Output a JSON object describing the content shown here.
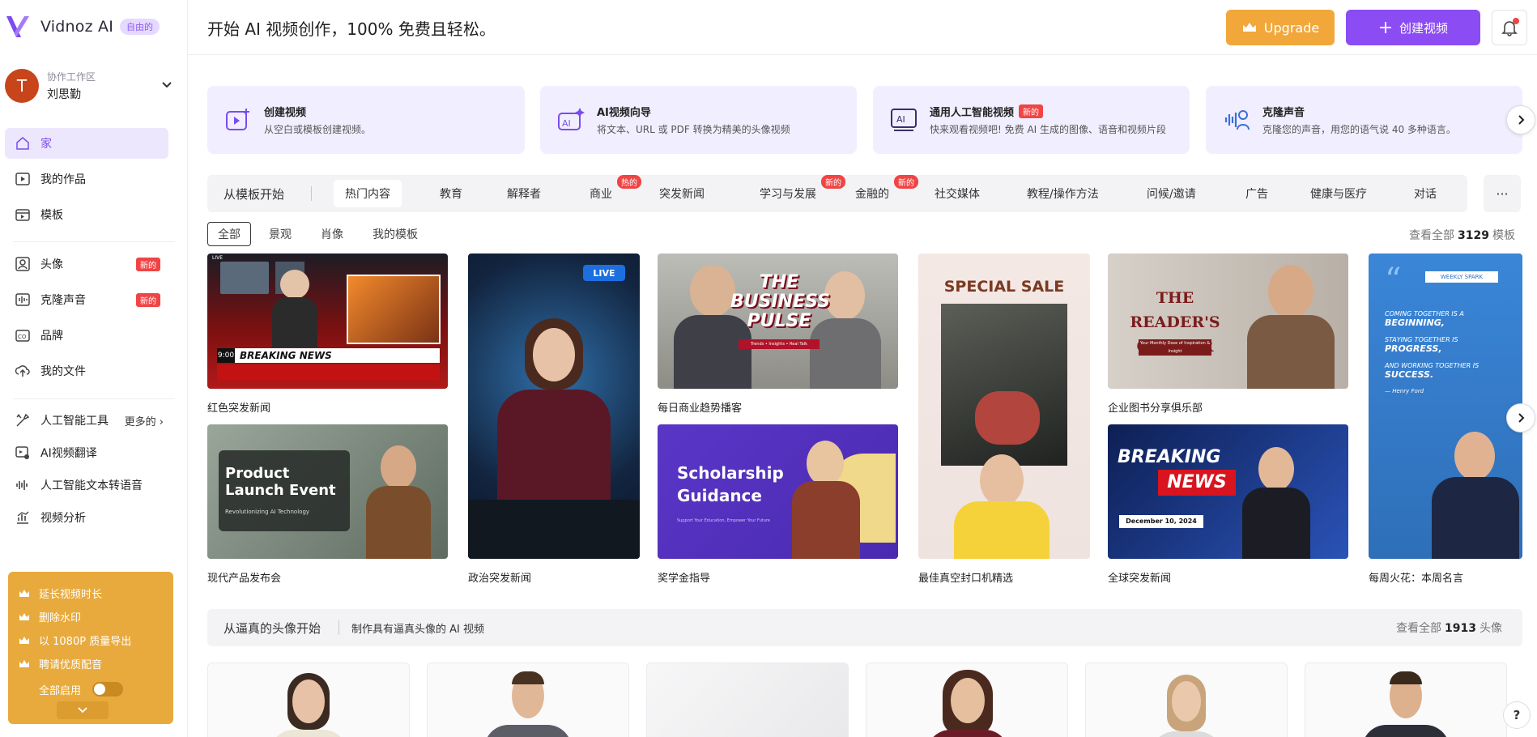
{
  "brand": {
    "name": "Vidnoz AI",
    "tag": "自由的"
  },
  "workspace": {
    "label": "协作工作区",
    "user": "刘思勤",
    "initial": "T"
  },
  "sidebar": {
    "items": [
      {
        "label": "家",
        "icon": "home-icon"
      },
      {
        "label": "我的作品",
        "icon": "video-icon"
      },
      {
        "label": "模板",
        "icon": "template-icon"
      },
      {
        "label": "头像",
        "icon": "avatar-icon",
        "badge": "新的"
      },
      {
        "label": "克隆声音",
        "icon": "voice-icon",
        "badge": "新的"
      },
      {
        "label": "品牌",
        "icon": "brand-icon"
      },
      {
        "label": "我的文件",
        "icon": "upload-icon"
      }
    ],
    "tools": {
      "label": "人工智能工具",
      "more": "更多的",
      "items": [
        {
          "label": "AI视频翻译",
          "icon": "translate-icon"
        },
        {
          "label": "人工智能文本转语音",
          "icon": "waveform-icon"
        },
        {
          "label": "视频分析",
          "icon": "analytics-icon"
        }
      ]
    },
    "promo": {
      "items": [
        "延长视频时长",
        "删除水印",
        "以 1080P 质量导出",
        "聘请优质配音"
      ],
      "toggle_label": "全部启用"
    }
  },
  "header": {
    "title": "开始 AI 视频创作，100% 免费且轻松。",
    "upgrade": "Upgrade",
    "create": "创建视频"
  },
  "features": [
    {
      "title": "创建视频",
      "desc": "从空白或模板创建视频。"
    },
    {
      "title": "AI视频向导",
      "desc": "将文本、URL 或 PDF 转换为精美的头像视频"
    },
    {
      "title": "通用人工智能视频",
      "badge": "新的",
      "desc": "快来观看视频吧! 免费 AI 生成的图像、语音和视频片段"
    },
    {
      "title": "克隆声音",
      "desc": "克隆您的声音，用您的语气说 40 多种语言。"
    }
  ],
  "categories": {
    "start_label": "从模板开始",
    "tabs": [
      {
        "label": "热门内容"
      },
      {
        "label": "教育"
      },
      {
        "label": "解释者"
      },
      {
        "label": "商业",
        "badge": "热的"
      },
      {
        "label": "突发新闻"
      },
      {
        "label": "学习与发展",
        "badge": "新的"
      },
      {
        "label": "金融的",
        "badge": "新的"
      },
      {
        "label": "社交媒体"
      },
      {
        "label": "教程/操作方法"
      },
      {
        "label": "问候/邀请"
      },
      {
        "label": "广告"
      },
      {
        "label": "健康与医疗"
      },
      {
        "label": "对话"
      }
    ],
    "more": "···"
  },
  "filters": [
    "全部",
    "景观",
    "肖像",
    "我的模板"
  ],
  "templates_viewall": {
    "prefix": "查看全部",
    "count": "3129",
    "suffix": "模板"
  },
  "templates": [
    {
      "caption": "红色突发新闻",
      "overlay": "BREAKING NEWS",
      "time": "9:00",
      "live": "LIVE"
    },
    {
      "caption": "政治突发新闻",
      "live": "LIVE"
    },
    {
      "caption": "每日商业趋势播客",
      "overlay": "THE BUSINESS PULSE",
      "sub": "Trends • Insights • Real Talk"
    },
    {
      "caption": "最佳真空封口机精选",
      "overlay": "SPECIAL SALE"
    },
    {
      "caption": "企业图书分享俱乐部",
      "overlay": "THE READER'S CORNER",
      "sub": "Your Monthly Dose of Inspiration & Insight"
    },
    {
      "caption": "每周火花：本周名言",
      "tag": "WEEKLY SPARK",
      "lines": [
        "COMING TOGETHER IS A",
        "BEGINNING,",
        "STAYING TOGETHER IS",
        "PROGRESS,",
        "AND WORKING TOGETHER IS",
        "SUCCESS.",
        "— Henry Ford"
      ]
    },
    {
      "caption": "现代产品发布会",
      "overlay": "Product Launch Event",
      "sub": "Revolutionizing AI Technology"
    },
    {
      "caption": "奖学金指导",
      "overlay": "Scholarship Guidance",
      "sub": "Support Your Education, Empower Your Future"
    },
    {
      "caption": "全球突发新闻",
      "overlay": "BREAKING",
      "overlay2": "NEWS",
      "date": "December 10, 2024"
    }
  ],
  "avatar_section": {
    "title": "从逼真的头像开始",
    "subtitle": "制作具有逼真头像的 AI 视频",
    "viewall_prefix": "查看全部",
    "count": "1913",
    "suffix": "头像"
  },
  "help": "?",
  "colors": {
    "accent": "#8b4cf3",
    "upgrade": "#f1a73a",
    "badge": "#f04545",
    "promo": "#e8aa3d"
  }
}
